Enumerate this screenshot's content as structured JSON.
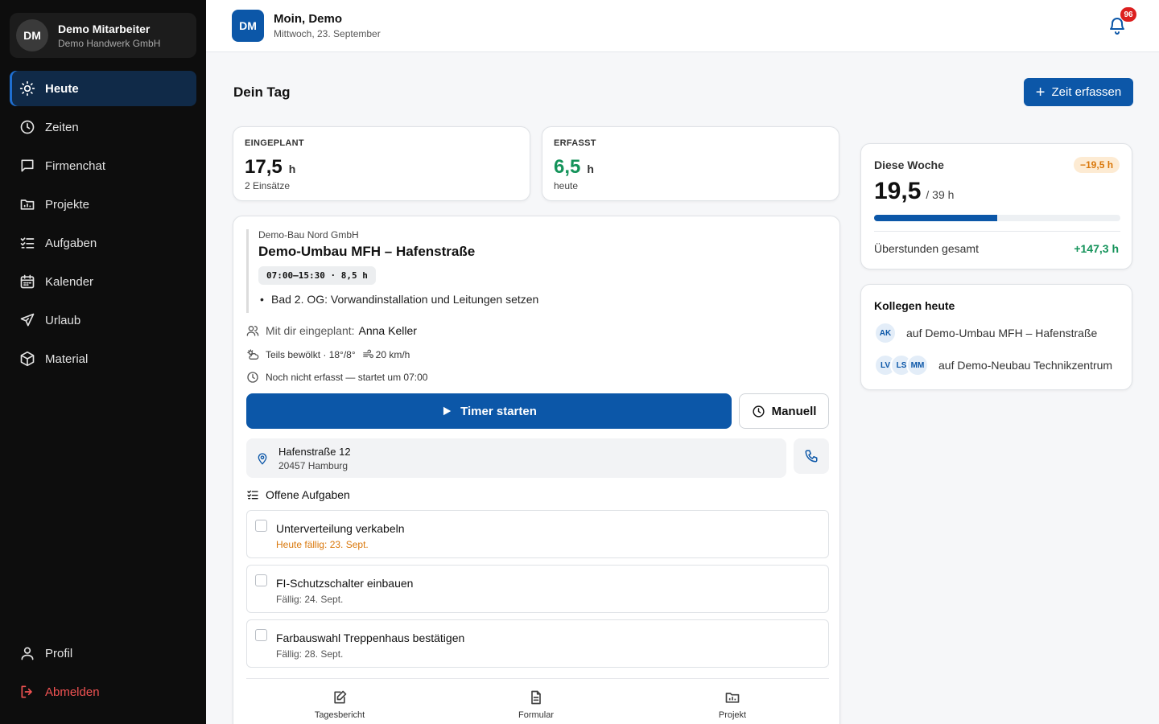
{
  "sidebar": {
    "user": {
      "initials": "DM",
      "name": "Demo Mitarbeiter",
      "company": "Demo Handwerk GmbH"
    },
    "items": [
      {
        "label": "Heute",
        "icon": "sun-icon",
        "active": true
      },
      {
        "label": "Zeiten",
        "icon": "clock-icon"
      },
      {
        "label": "Firmenchat",
        "icon": "chat-icon"
      },
      {
        "label": "Projekte",
        "icon": "folder-icon"
      },
      {
        "label": "Aufgaben",
        "icon": "list-check-icon"
      },
      {
        "label": "Kalender",
        "icon": "calendar-icon"
      },
      {
        "label": "Urlaub",
        "icon": "plane-icon"
      },
      {
        "label": "Material",
        "icon": "box-icon"
      }
    ],
    "bottom": [
      {
        "label": "Profil",
        "icon": "user-icon"
      },
      {
        "label": "Abmelden",
        "icon": "logout-icon"
      }
    ]
  },
  "header": {
    "initials": "DM",
    "greeting": "Moin, Demo",
    "date": "Mittwoch, 23. September",
    "notifications": "96"
  },
  "main": {
    "title": "Dein Tag",
    "add_button": "Zeit erfassen",
    "planned": {
      "label": "EINGEPLANT",
      "value": "17,5",
      "unit": "h",
      "sub": "2 Einsätze"
    },
    "recorded": {
      "label": "ERFASST",
      "value": "6,5",
      "unit": "h",
      "sub": "heute"
    },
    "assignment": {
      "customer": "Demo-Bau Nord GmbH",
      "project": "Demo-Umbau MFH – Hafenstraße",
      "time": "07:00–15:30 · 8,5 h",
      "task": "Bad 2. OG: Vorwandinstallation und Leitungen setzen",
      "planned_with_label": "Mit dir eingeplant:",
      "planned_with_name": "Anna Keller",
      "weather": "Teils bewölkt · 18°/8°",
      "wind": "20 km/h",
      "status": "Noch nicht erfasst — startet um 07:00",
      "timer_button": "Timer starten",
      "manual_button": "Manuell",
      "address_street": "Hafenstraße 12",
      "address_city": "20457 Hamburg",
      "open_tasks_title": "Offene Aufgaben",
      "tasks": [
        {
          "name": "Unterverteilung verkabeln",
          "due": "Heute fällig: 23. Sept."
        },
        {
          "name": "FI-Schutzschalter einbauen",
          "due": "Fällig: 24. Sept."
        },
        {
          "name": "Farbauswahl Treppenhaus bestätigen",
          "due": "Fällig: 28. Sept."
        }
      ],
      "actions": [
        "Tagesbericht",
        "Formular",
        "Projekt"
      ]
    }
  },
  "week": {
    "title": "Diese Woche",
    "badge": "−19,5 h",
    "value": "19,5",
    "target": "/ 39 h",
    "progress": 0.5,
    "overtime_label": "Überstunden gesamt",
    "overtime_value": "+147,3 h"
  },
  "colleagues": {
    "title": "Kollegen heute",
    "rows": [
      {
        "avatars": [
          "AK"
        ],
        "text": "auf Demo-Umbau MFH – Hafenstraße"
      },
      {
        "avatars": [
          "LV",
          "LS",
          "MM"
        ],
        "text": "auf Demo-Neubau Technikzentrum"
      }
    ]
  },
  "colors": {
    "primary": "#0c57a8",
    "sidebar": "#0d0d0d",
    "success": "#14935a",
    "warning": "#d9770a",
    "danger": "#dc1f1f"
  }
}
